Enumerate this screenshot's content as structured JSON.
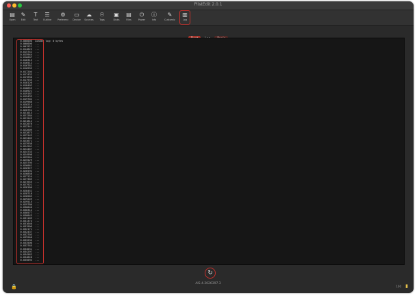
{
  "window": {
    "title": "PlistEdit 2.0.1"
  },
  "toolbar": {
    "items": [
      {
        "label": "Open",
        "icon": "doc-icon"
      },
      {
        "label": "Edit",
        "icon": "pencil-icon"
      },
      {
        "label": "Text",
        "icon": "text-icon"
      },
      {
        "label": "Outline",
        "icon": "outline-icon"
      },
      {
        "label": "Preferences",
        "icon": "gear-icon"
      },
      {
        "label": "Device",
        "icon": "device-icon"
      },
      {
        "label": "Sources",
        "icon": "cloud-icon"
      },
      {
        "label": "Tags",
        "icon": "bulb-icon"
      },
      {
        "label": "Disks",
        "icon": "disk-icon"
      },
      {
        "label": "Files",
        "icon": "files-icon"
      },
      {
        "label": "Power",
        "icon": "power-icon"
      },
      {
        "label": "Info",
        "icon": "info-icon"
      },
      {
        "label": "Customize",
        "icon": "pencil-icon"
      },
      {
        "label": "Log",
        "icon": "log-icon"
      }
    ]
  },
  "segments": [
    {
      "label": "Boot",
      "state": "on"
    },
    {
      "label": "Log",
      "state": "off"
    },
    {
      "label": "Panic",
      "state": "alt"
    }
  ],
  "console": {
    "lines": [
      "   0.000000  Loaded log: 0 bytes",
      "   0.000000  ...",
      "   0.001521  ...",
      "   0.014823  ...",
      "   0.015742  ...",
      "   0.015944  ...",
      "   0.016007  ...",
      "   0.016315  ...",
      "   0.016512  ...",
      "   0.016781  ...",
      "   0.016995  ...",
      "   0.017204  ...",
      "   0.017432  ...",
      "   0.017698  ...",
      "   0.017935  ...",
      "   0.018126  ...",
      "   0.018402  ...",
      "   0.018655  ...",
      "   0.018921  ...",
      "   0.019187  ...",
      "   0.019433  ...",
      "   0.019702  ...",
      "   0.019968  ...",
      "   0.020214  ...",
      "   0.020487  ...",
      "   0.020751  ...",
      "   0.021013  ...",
      "   0.021284  ...",
      "   0.021549  ...",
      "   0.021812  ...",
      "   0.022078  ...",
      "   0.022341  ...",
      "   0.022609  ...",
      "   0.022873  ...",
      "   0.023142  ...",
      "   0.023405  ...",
      "   0.023671  ...",
      "   0.023938  ...",
      "   0.024201  ...",
      "   0.024467  ...",
      "   0.024733  ...",
      "   0.024998  ...",
      "   0.025264  ...",
      "   0.025529  ...",
      "   0.025795  ...",
      "   0.026061  ...",
      "   0.026327  ...",
      "   0.026592  ...",
      "   0.026858  ...",
      "   0.027124  ...",
      "   0.027389  ...",
      "   0.027655  ...",
      "   0.027921  ...",
      "   0.028186  ...",
      "   0.028452  ...",
      "   0.028718  ...",
      "   0.028983  ...",
      "   0.029249  ...",
      "   0.029515  ...",
      "   0.029780  ...",
      "   0.030046  ...",
      "   0.030312  ...",
      "   0.030577  ...",
      "   0.030843  ...",
      "   0.031109  ...",
      "   0.031374  ...",
      "   0.031640  ...",
      "   0.031906  ...",
      "   0.032171  ...",
      "   0.032437  ...",
      "   0.032703  ...",
      "   0.032968  ...",
      "   0.033234  ...",
      "   0.033500  ...",
      "   0.033765  ...",
      "   0.034031  ...",
      "   0.034297  ...",
      "   0.034562  ...",
      "   0.034828  ...",
      "   0.035094  ..."
    ]
  },
  "footer": {
    "text": "AIS 4.2026397.3"
  },
  "status": {
    "battery_label": "100"
  },
  "colors": {
    "accent": "#c4312c",
    "window_bg": "#2a2a2a",
    "console_bg": "#161616"
  }
}
